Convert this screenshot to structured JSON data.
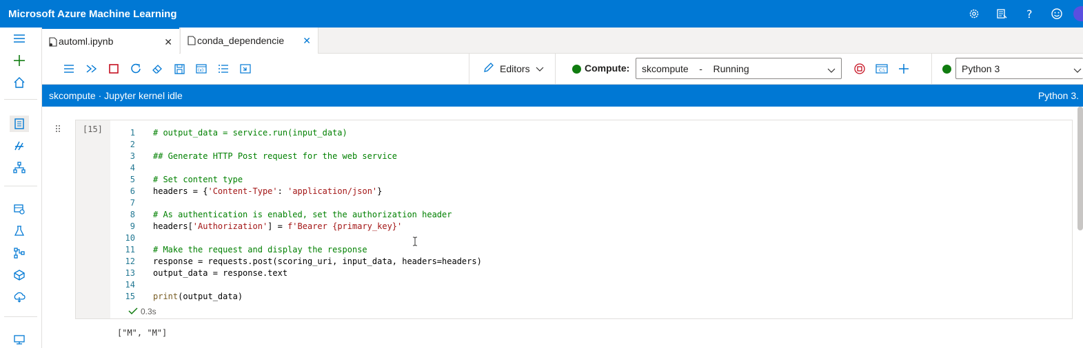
{
  "app": {
    "title": "Microsoft Azure Machine Learning"
  },
  "topbar_icons": [
    "gear-icon",
    "feedback-list-icon",
    "help-icon",
    "smiley-icon"
  ],
  "leftnav": [
    "hamburger-icon",
    "plus-icon",
    "home-icon",
    "notebook-icon",
    "automl-icon",
    "designer-icon",
    "datasets-icon",
    "experiments-icon",
    "pipelines-icon",
    "models-icon",
    "endpoints-icon",
    "compute-icon"
  ],
  "tabs": [
    {
      "label": "automl.ipynb",
      "active": true
    },
    {
      "label": "conda_dependencie",
      "active": false
    }
  ],
  "toolbar": {
    "editors_label": "Editors",
    "compute_label": "Compute:",
    "compute_value": "skcompute    -    Running",
    "kernel_value": "Python 3"
  },
  "status": {
    "left": "skcompute · Jupyter kernel idle",
    "right": "Python 3."
  },
  "cell": {
    "exec_count": "[15]",
    "lines": [
      {
        "n": "1",
        "text": "# output_data = service.run(input_data)"
      },
      {
        "n": "2",
        "text": ""
      },
      {
        "n": "3",
        "text": "## Generate HTTP Post request for the web service"
      },
      {
        "n": "4",
        "text": ""
      },
      {
        "n": "5",
        "text": "# Set content type"
      },
      {
        "n": "6",
        "text": "headers = {'Content-Type': 'application/json'}"
      },
      {
        "n": "7",
        "text": ""
      },
      {
        "n": "8",
        "text": "# As authentication is enabled, set the authorization header"
      },
      {
        "n": "9",
        "text": "headers['Authorization'] = f'Bearer {primary_key}'"
      },
      {
        "n": "10",
        "text": ""
      },
      {
        "n": "11",
        "text": "# Make the request and display the response"
      },
      {
        "n": "12",
        "text": "response = requests.post(scoring_uri, input_data, headers=headers)"
      },
      {
        "n": "13",
        "text": "output_data = response.text"
      },
      {
        "n": "14",
        "text": ""
      },
      {
        "n": "15",
        "text": "print(output_data)"
      }
    ],
    "timing": "0.3s",
    "output": "[\"M\", \"M\"]"
  },
  "colors": {
    "brand": "#0078d4",
    "running": "#107c10",
    "comment": "#008000",
    "string": "#a31515"
  }
}
